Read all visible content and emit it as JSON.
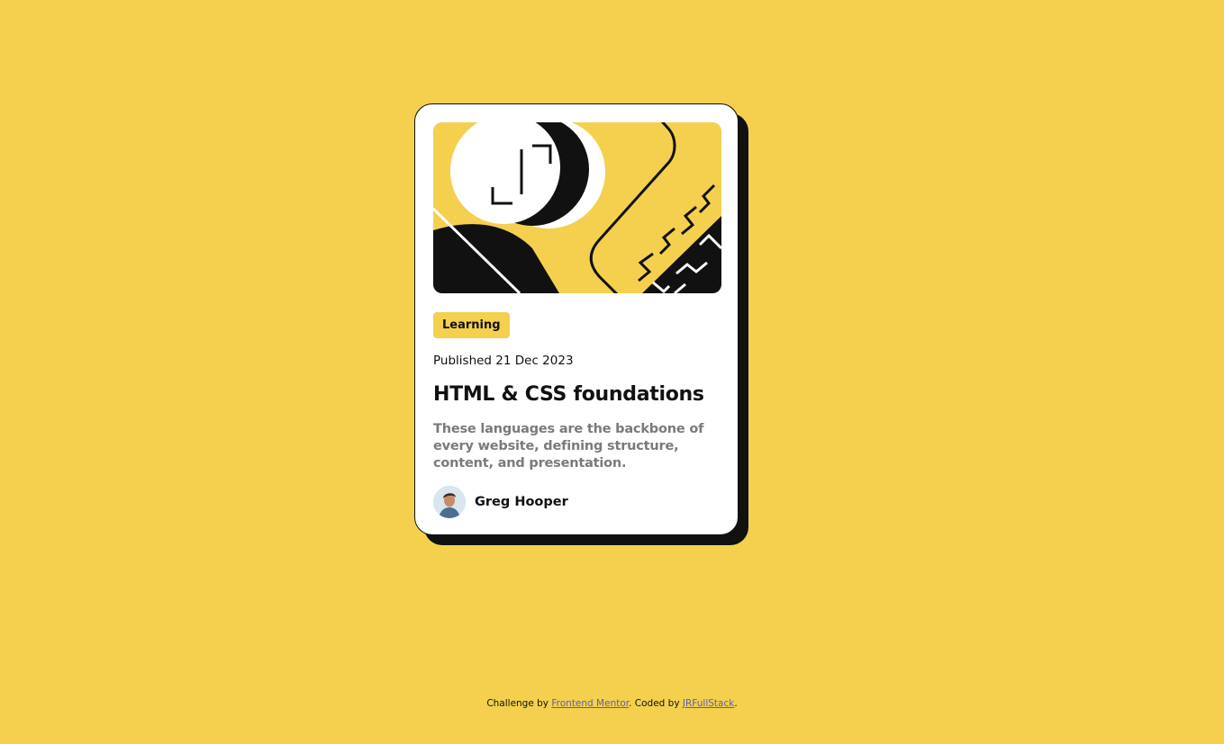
{
  "colors": {
    "background": "#F4D04E",
    "card": "#FFFFFF",
    "ink": "#111111",
    "muted_text": "#7a7a7a",
    "link": "#5a5fb0"
  },
  "card": {
    "hero_image": "abstract-illustration",
    "tag": "Learning",
    "published_label": "Published",
    "published_date": "21 Dec 2023",
    "title": "HTML & CSS foundations",
    "description": "These languages are the backbone of every website, defining structure, content, and presentation.",
    "author": {
      "avatar_icon": "author-avatar",
      "name": "Greg Hooper"
    }
  },
  "footer": {
    "prefix": "Challenge by",
    "challenge_link": "Frontend Mentor",
    "middle": ". Coded by",
    "author_link": "JRFullStack",
    "suffix": "."
  }
}
